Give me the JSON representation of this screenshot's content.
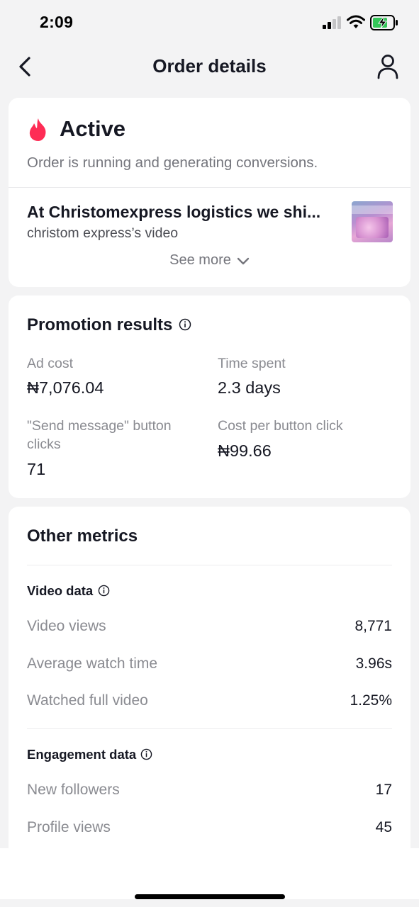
{
  "status_bar": {
    "time": "2:09"
  },
  "header": {
    "title": "Order details"
  },
  "order_status": {
    "title": "Active",
    "description": "Order is running and generating conversions.",
    "video_title": "At Christomexpress logistics we shi...",
    "video_owner": "christom express’s video",
    "see_more": "See more"
  },
  "promotion": {
    "title": "Promotion results",
    "metrics": [
      {
        "label": "Ad cost",
        "value": "₦7,076.04"
      },
      {
        "label": "Time spent",
        "value": "2.3 days"
      },
      {
        "label": "\"Send message\" button clicks",
        "value": "71"
      },
      {
        "label": "Cost per button click",
        "value": "₦99.66"
      }
    ]
  },
  "other_metrics": {
    "title": "Other metrics",
    "video_data": {
      "title": "Video data",
      "rows": [
        {
          "label": "Video views",
          "value": "8,771"
        },
        {
          "label": "Average watch time",
          "value": "3.96s"
        },
        {
          "label": "Watched full video",
          "value": "1.25%"
        }
      ]
    },
    "engagement_data": {
      "title": "Engagement data",
      "rows": [
        {
          "label": "New followers",
          "value": "17"
        },
        {
          "label": "Profile views",
          "value": "45"
        }
      ]
    }
  },
  "colors": {
    "fire": "#fe2c55",
    "text_primary": "#161823",
    "text_secondary": "#8a8b91",
    "battery_fill": "#34c759"
  }
}
